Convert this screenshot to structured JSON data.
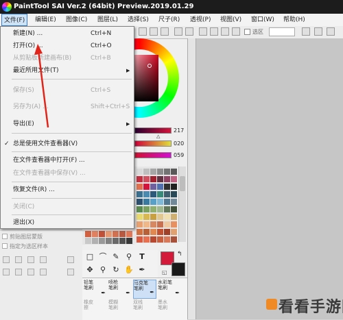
{
  "window": {
    "title": "PaintTool SAI Ver.2 (64bit) Preview.2019.01.29"
  },
  "menubar": [
    {
      "label": "文件(F)",
      "active": true
    },
    {
      "label": "编辑(E)"
    },
    {
      "label": "图像(C)"
    },
    {
      "label": "图层(L)"
    },
    {
      "label": "选择(S)"
    },
    {
      "label": "尺子(R)"
    },
    {
      "label": "透视(P)"
    },
    {
      "label": "视图(V)"
    },
    {
      "label": "窗口(W)"
    },
    {
      "label": "帮助(H)"
    }
  ],
  "toolbar": {
    "select_label": "选区"
  },
  "file_menu": {
    "items": [
      {
        "label": "新建(N) ...",
        "shortcut": "Ctrl+N"
      },
      {
        "label": "打开(O) ...",
        "shortcut": "Ctrl+O"
      },
      {
        "label": "从剪贴板新建画布(B)",
        "shortcut": "Ctrl+B",
        "disabled": true
      },
      {
        "label": "最近所用文件(T)",
        "submenu": true
      },
      {
        "label": "保存(S)",
        "shortcut": "Ctrl+S",
        "disabled": true
      },
      {
        "label": "另存为(A) ...",
        "shortcut": "Shift+Ctrl+S",
        "disabled": true
      },
      {
        "label": "导出(E)",
        "submenu": true
      },
      {
        "label": "总是使用文件查看器(V)",
        "checked": true
      },
      {
        "label": "在文件查看器中打开(F) ..."
      },
      {
        "label": "在文件查看器中保存(V) ...",
        "disabled": true
      },
      {
        "label": "恢复文件(R) ..."
      },
      {
        "label": "关闭(C)",
        "disabled": true
      },
      {
        "label": "退出(X)"
      }
    ]
  },
  "color_panel": {
    "rgb_values": [
      "217",
      "020",
      "059"
    ],
    "foreground_color": "#d41a3a",
    "background_color": "#1a1a1a"
  },
  "layer_options": {
    "option1": "剪贴图层蒙版",
    "option2": "指定为选区样本"
  },
  "brushes": [
    {
      "name": "铅笔",
      "sub": "笔刷"
    },
    {
      "name": "喷枪",
      "sub": "笔刷"
    },
    {
      "name": "马克笔",
      "sub": "笔刷"
    },
    {
      "name": "水彩笔",
      "sub": "笔刷"
    },
    {
      "name": "橡皮",
      "sub": "擦"
    },
    {
      "name": "模糊",
      "sub": "笔刷"
    },
    {
      "name": "双线",
      "sub": "笔刷"
    },
    {
      "name": "墨水",
      "sub": "笔刷"
    }
  ],
  "watermark": {
    "text": "看看手游网"
  },
  "icons": {
    "menu_submenu": "chevron-right-icon",
    "check": "checkmark-icon",
    "swap": "swap-colors-icon"
  }
}
